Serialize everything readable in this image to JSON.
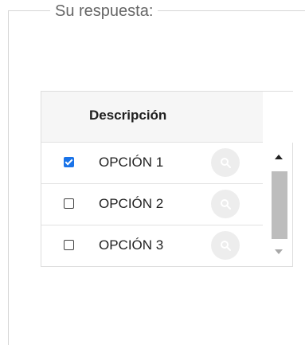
{
  "fieldset": {
    "legend": "Su respuesta:"
  },
  "table": {
    "header": "Descripción",
    "rows": [
      {
        "label": "OPCIÓN 1",
        "checked": true,
        "icon": "search-icon"
      },
      {
        "label": "OPCIÓN 2",
        "checked": false,
        "icon": "search-icon"
      },
      {
        "label": "OPCIÓN 3",
        "checked": false,
        "icon": "search-icon"
      }
    ]
  },
  "colors": {
    "checkbox_checked": "#1a73e8",
    "legend_text": "#666666",
    "header_bg": "#f6f6f6",
    "search_button_bg": "#ededed",
    "scroll_thumb": "#bdbdbd"
  }
}
